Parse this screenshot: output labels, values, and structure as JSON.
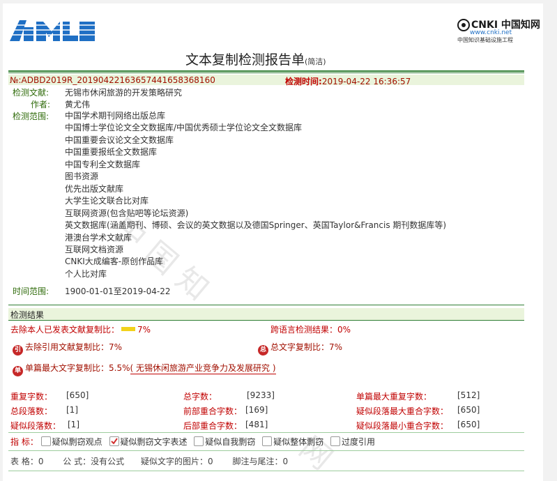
{
  "header": {
    "title": "文本复制检测报告单",
    "title_suffix": "(简洁)",
    "cnki_brand": "CNKI 中国知网",
    "cnki_url": "www.cnki.net",
    "cnki_sub": "中国知识基础设施工程"
  },
  "report": {
    "number_label": "№:",
    "number": "ADBD2019R_20190422163657441658368160",
    "time_label": "检测时间:",
    "time": "2019-04-22 16:36:57",
    "doc_label": "检测文献:",
    "doc": "无锡市休闲旅游的开发策略研究",
    "author_label": "作者:",
    "author": "黄尤伟",
    "scope_label": "检测范围:",
    "scope": [
      "中国学术期刊网络出版总库",
      "中国博士学位论文全文数据库/中国优秀硕士学位论文全文数据库",
      "中国重要会议论文全文数据库",
      "中国重要报纸全文数据库",
      "中国专利全文数据库",
      "图书资源",
      "优先出版文献库",
      "大学生论文联合比对库",
      "互联网资源(包含贴吧等论坛资源)",
      "英文数据库(涵盖期刊、博硕、会议的英文数据以及德国Springer、英国Taylor&Francis 期刊数据库等)",
      "港澳台学术文献库",
      "互联网文档资源",
      "CNKI大成编客-原创作品库",
      "个人比对库"
    ],
    "range_label": "时间范围:",
    "range": "1900-01-01至2019-04-22"
  },
  "results": {
    "section_title": "检测结果",
    "self_excl_label": "去除本人已发表文献复制比：",
    "self_excl_value": "7%",
    "cross_lang_label": "跨语言检测结果：",
    "cross_lang_value": "0%",
    "quote_excl_icon": "引",
    "quote_excl_label": "去除引用文献复制比：",
    "quote_excl_value": "7%",
    "total_icon": "总",
    "total_label": "总文字复制比：",
    "total_value": "7%",
    "single_icon": "单",
    "single_label": "单篇最大文字复制比：",
    "single_value": "5.5%",
    "single_source": "( 无锡休闲旅游产业竞争力及发展研究 )",
    "bar_color": "#f2d21b"
  },
  "stats": {
    "dup_chars_label": "重复字数：",
    "dup_chars": "[650]",
    "total_chars_label": "总字数：",
    "total_chars": "[9233]",
    "single_max_label": "单篇最大重复字数：",
    "single_max": "[512]",
    "total_paras_label": "总段落数：",
    "total_paras": "[1]",
    "front_label": "前部重合字数：",
    "front": "[169]",
    "susp_max_label": "疑似段落最大重合字数：",
    "susp_max": "[650]",
    "susp_paras_label": "疑似段落数：",
    "susp_paras": "[1]",
    "back_label": "后部重合字数：",
    "back": "[481]",
    "susp_min_label": "疑似段落最小重合字数：",
    "susp_min": "[650]"
  },
  "indicators": {
    "label": "指 标：",
    "items": [
      {
        "label": "疑似剽窃观点",
        "checked": false
      },
      {
        "label": "疑似剽窃文字表述",
        "checked": true
      },
      {
        "label": "疑似自我剽窃",
        "checked": false
      },
      {
        "label": "疑似整体剽窃",
        "checked": false
      },
      {
        "label": "过度引用",
        "checked": false
      }
    ]
  },
  "footer": {
    "tables_label": "表 格：",
    "tables": "0",
    "formula_label": "公 式：",
    "formula": "没有公式",
    "images_label": "疑似文字的图片：",
    "images": "0",
    "notes_label": "脚注与尾注：",
    "notes": "0"
  },
  "colors": {
    "accent_green": "#2e7d32",
    "label_red": "#c00000",
    "icon_red": "#c62828"
  }
}
